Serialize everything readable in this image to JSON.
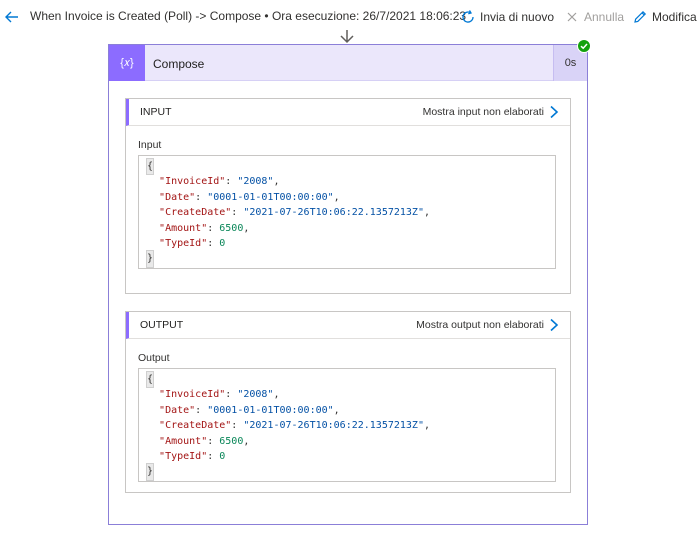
{
  "topbar": {
    "title": "When Invoice is Created (Poll) -> Compose • Ora esecuzione: 26/7/2021 18:06:23",
    "resubmit_label": "Invia di nuovo",
    "cancel_label": "Annulla",
    "edit_label": "Modifica",
    "icons": {
      "back": "arrow-left-icon",
      "resubmit": "refresh-icon",
      "cancel": "close-icon",
      "edit": "pencil-icon"
    }
  },
  "action": {
    "icon": "compose-icon",
    "icon_glyph": "{𝑥}",
    "title": "Compose",
    "duration": "0s",
    "status": "succeeded",
    "accent_color": "#8c6cff"
  },
  "input": {
    "section_title": "INPUT",
    "raw_link": "Mostra input non elaborati",
    "field_label": "Input",
    "json": {
      "open": "{",
      "close": "}",
      "lines": [
        {
          "key": "\"InvoiceId\"",
          "value": "\"2008\"",
          "type": "s",
          "trail": ","
        },
        {
          "key": "\"Date\"",
          "value": "\"0001-01-01T00:00:00\"",
          "type": "s",
          "trail": ","
        },
        {
          "key": "\"CreateDate\"",
          "value": "\"2021-07-26T10:06:22.1357213Z\"",
          "type": "s",
          "trail": ","
        },
        {
          "key": "\"Amount\"",
          "value": "6500",
          "type": "n",
          "trail": ","
        },
        {
          "key": "\"TypeId\"",
          "value": "0",
          "type": "n",
          "trail": ""
        }
      ]
    }
  },
  "output": {
    "section_title": "OUTPUT",
    "raw_link": "Mostra output non elaborati",
    "field_label": "Output",
    "json": {
      "open": "{",
      "close": "}",
      "lines": [
        {
          "key": "\"InvoiceId\"",
          "value": "\"2008\"",
          "type": "s",
          "trail": ","
        },
        {
          "key": "\"Date\"",
          "value": "\"0001-01-01T00:00:00\"",
          "type": "s",
          "trail": ","
        },
        {
          "key": "\"CreateDate\"",
          "value": "\"2021-07-26T10:06:22.1357213Z\"",
          "type": "s",
          "trail": ","
        },
        {
          "key": "\"Amount\"",
          "value": "6500",
          "type": "n",
          "trail": ","
        },
        {
          "key": "\"TypeId\"",
          "value": "0",
          "type": "n",
          "trail": ""
        }
      ]
    }
  }
}
